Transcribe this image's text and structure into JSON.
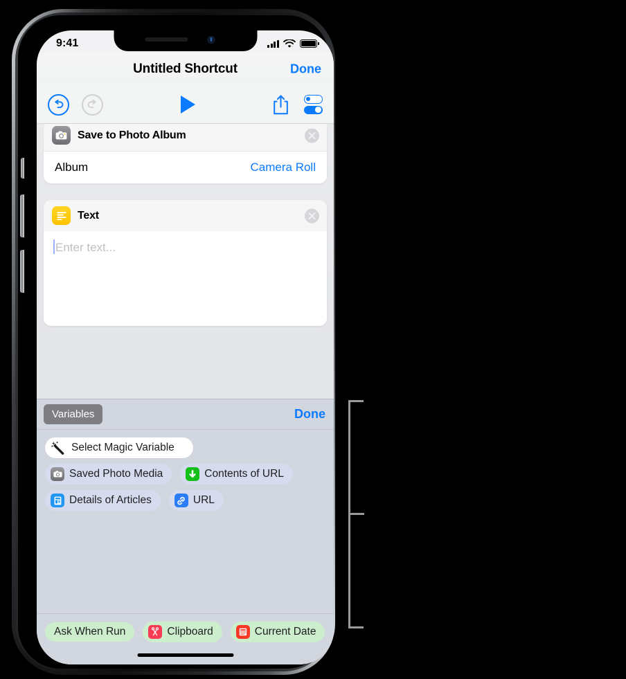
{
  "status_bar": {
    "time": "9:41",
    "cellular_icon": "signal-bars-icon",
    "wifi_icon": "wifi-icon",
    "battery_icon": "battery-full-icon"
  },
  "nav_bar": {
    "title": "Untitled Shortcut",
    "done_label": "Done"
  },
  "toolbar": {
    "undo_icon": "undo-icon",
    "redo_icon": "redo-icon",
    "play_icon": "play-icon",
    "share_icon": "share-icon",
    "settings_icon": "settings-toggles-icon"
  },
  "actions": [
    {
      "icon": "camera-icon",
      "title": "Save to Photo Album",
      "remove_icon": "close-circle-icon",
      "parameters": [
        {
          "label": "Album",
          "value": "Camera Roll"
        }
      ]
    },
    {
      "icon": "text-lines-icon",
      "title": "Text",
      "remove_icon": "close-circle-icon",
      "text_field": {
        "value": "",
        "placeholder": "Enter text..."
      }
    }
  ],
  "accessory_bar": {
    "variables_label": "Variables",
    "done_label": "Done"
  },
  "variables_panel": {
    "select_magic_variable": {
      "label": "Select Magic Variable",
      "icon": "magic-wand-icon"
    },
    "magic_variables": [
      {
        "label": "Saved Photo Media",
        "icon": "camera-icon"
      },
      {
        "label": "Contents of URL",
        "icon": "download-arrow-icon"
      },
      {
        "label": "Details of Articles",
        "icon": "document-icon"
      },
      {
        "label": "URL",
        "icon": "link-icon"
      }
    ],
    "special_variables": [
      {
        "label": "Ask When Run",
        "icon": ""
      },
      {
        "label": "Clipboard",
        "icon": "scissors-icon"
      },
      {
        "label": "Current Date",
        "icon": "calendar-icon"
      }
    ]
  },
  "colors": {
    "accent_blue": "#0a7bff",
    "magic_chip": "#d6dcee",
    "special_chip": "#cdeecd",
    "panel_background": "#d2d6de",
    "text_icon_yellow": "#ffc400"
  },
  "callout": {
    "bracket_icon": "callout-bracket-icon"
  }
}
